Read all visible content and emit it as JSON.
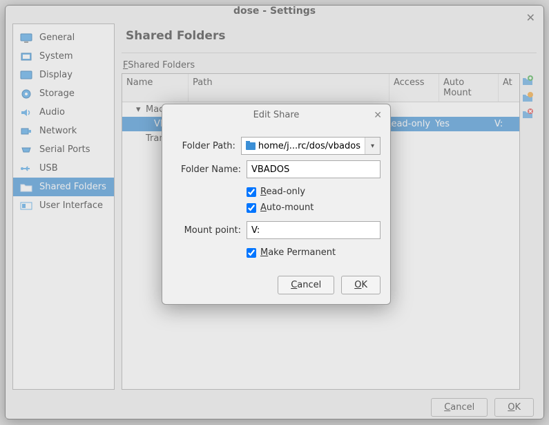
{
  "window": {
    "title": "dose - Settings"
  },
  "sidebar": {
    "items": [
      {
        "label": "General"
      },
      {
        "label": "System"
      },
      {
        "label": "Display"
      },
      {
        "label": "Storage"
      },
      {
        "label": "Audio"
      },
      {
        "label": "Network"
      },
      {
        "label": "Serial Ports"
      },
      {
        "label": "USB"
      },
      {
        "label": "Shared Folders"
      },
      {
        "label": "User Interface"
      }
    ]
  },
  "main": {
    "title": "Shared Folders",
    "section_label": "Shared Folders",
    "columns": {
      "name": "Name",
      "path": "Path",
      "access": "Access",
      "auto": "Auto Mount",
      "at": "At"
    },
    "rows": {
      "group1": "Machine Folders",
      "row1": {
        "name": "VBADOS",
        "access": "Read-only",
        "auto": "Yes",
        "at": "V:"
      },
      "group2": "Transient Folders"
    }
  },
  "modal": {
    "title": "Edit Share",
    "labels": {
      "folder_path": "Folder Path:",
      "folder_name": "Folder Name:",
      "mount_point": "Mount point:"
    },
    "values": {
      "folder_path": "home/j...rc/dos/vbados",
      "folder_name": "VBADOS",
      "mount_point": "V:"
    },
    "checks": {
      "read_only": "Read-only",
      "auto_mount": "Auto-mount",
      "make_permanent": "Make Permanent"
    },
    "buttons": {
      "cancel": "Cancel",
      "ok": "OK"
    }
  },
  "footer": {
    "cancel": "Cancel",
    "ok": "OK"
  }
}
